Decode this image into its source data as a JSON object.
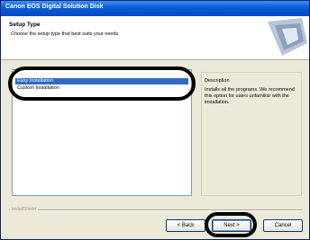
{
  "window": {
    "title": "Canon EOS Digital Solution Disk"
  },
  "header": {
    "title": "Setup Type",
    "subtitle": "Choose the setup type that best suits your needs."
  },
  "setup_list": {
    "items": [
      {
        "label": "Easy Installation",
        "selected": true
      },
      {
        "label": "Custom Installation",
        "selected": false
      }
    ]
  },
  "description": {
    "label": "Description",
    "text": "Installs all the programs. We recommend this option for users unfamiliar with the installation."
  },
  "footer": {
    "brand": "InstallShield"
  },
  "buttons": {
    "back": "< Back",
    "next": "Next >",
    "cancel": "Cancel"
  },
  "colors": {
    "titlebar": "#0a5fd8",
    "selection": "#316ac5",
    "dialog_bg": "#ece9d8",
    "annotation": "#000000"
  }
}
